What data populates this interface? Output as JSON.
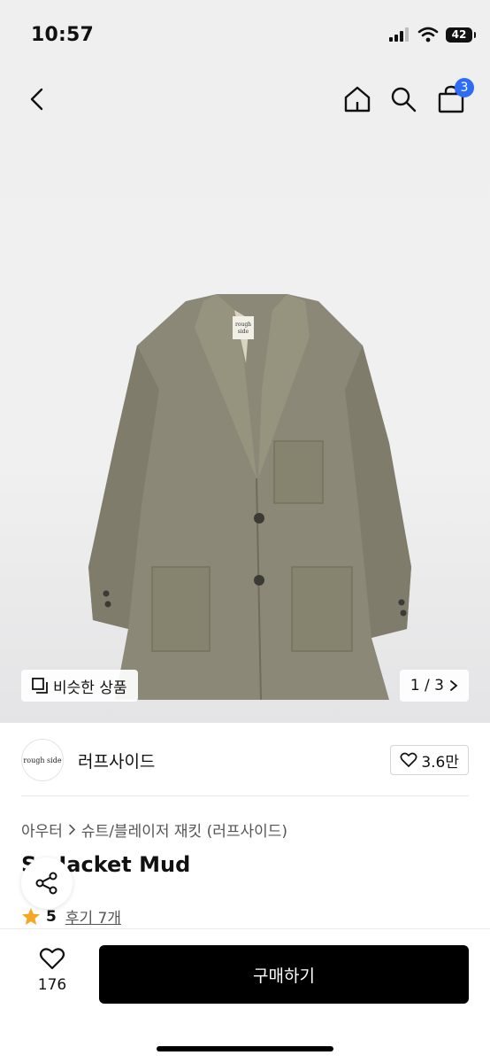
{
  "status_bar": {
    "time": "10:57",
    "battery": "42"
  },
  "nav": {
    "cart_count": "3"
  },
  "image_overlay": {
    "similar_label": "비슷한 상품",
    "pager": "1 / 3",
    "jacket_tag": "rough side"
  },
  "store": {
    "logo_text": "rough side",
    "name": "러프사이드",
    "likes": "3.6만"
  },
  "breadcrumb": {
    "category": "아우터",
    "subcategory": "슈트/블레이저 재킷 (러프사이드)"
  },
  "product": {
    "title": "S   Jacket Mud",
    "rating": "5",
    "reviews": "후기 7개"
  },
  "bottom": {
    "wish_count": "176",
    "buy_label": "구매하기"
  }
}
